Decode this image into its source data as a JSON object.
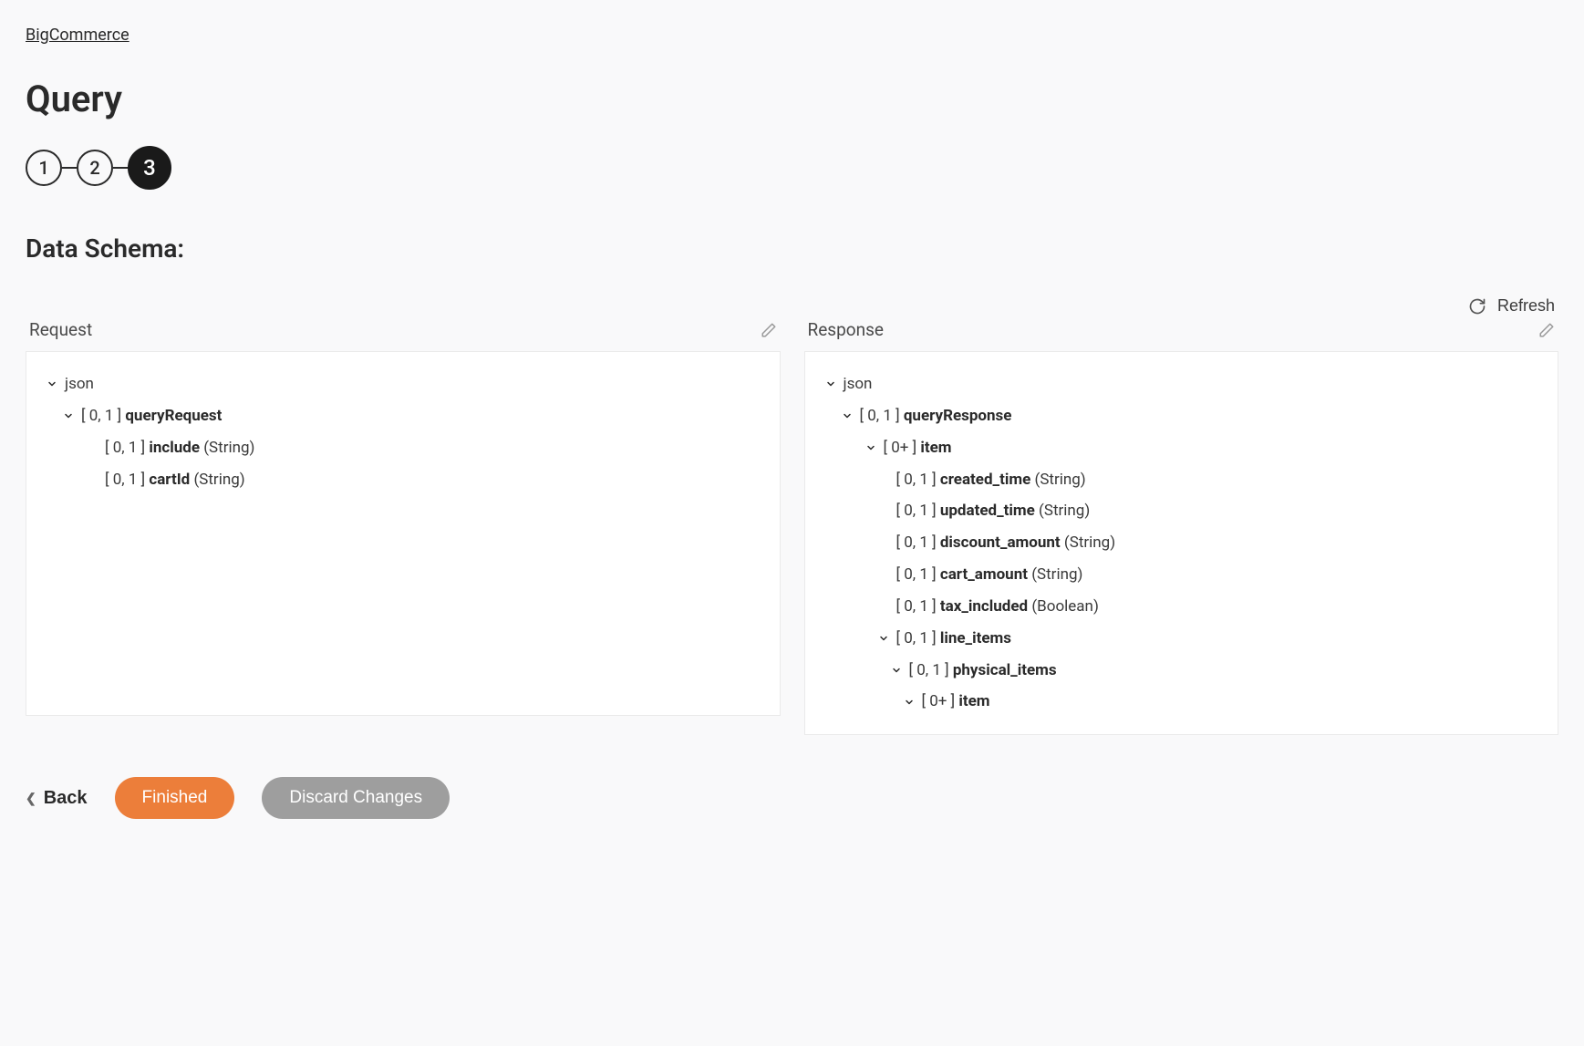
{
  "breadcrumb": {
    "label": "BigCommerce"
  },
  "page": {
    "title": "Query"
  },
  "stepper": {
    "steps": [
      "1",
      "2",
      "3"
    ],
    "activeIndex": 2
  },
  "section": {
    "title": "Data Schema:"
  },
  "refresh": {
    "label": "Refresh"
  },
  "request": {
    "label": "Request",
    "tree": [
      {
        "indent": 0,
        "chev": true,
        "text": "json"
      },
      {
        "indent": 1,
        "chev": true,
        "cardinality": "[ 0, 1 ]",
        "name": "queryRequest"
      },
      {
        "indent": 2,
        "chev": false,
        "cardinality": "[ 0, 1 ]",
        "name": "include",
        "type": "(String)"
      },
      {
        "indent": 2,
        "chev": false,
        "cardinality": "[ 0, 1 ]",
        "name": "cartId",
        "type": "(String)"
      }
    ]
  },
  "response": {
    "label": "Response",
    "tree": [
      {
        "indent": 0,
        "chev": true,
        "text": "json"
      },
      {
        "indent": 1,
        "chev": true,
        "cardinality": "[ 0, 1 ]",
        "name": "queryResponse"
      },
      {
        "indent": 2,
        "chev": true,
        "cardinality": "[ 0+ ]",
        "name": "item"
      },
      {
        "indent": 3,
        "chev": false,
        "cardinality": "[ 0, 1 ]",
        "name": "created_time",
        "type": "(String)"
      },
      {
        "indent": 3,
        "chev": false,
        "cardinality": "[ 0, 1 ]",
        "name": "updated_time",
        "type": "(String)"
      },
      {
        "indent": 3,
        "chev": false,
        "cardinality": "[ 0, 1 ]",
        "name": "discount_amount",
        "type": "(String)"
      },
      {
        "indent": 3,
        "chev": false,
        "cardinality": "[ 0, 1 ]",
        "name": "cart_amount",
        "type": "(String)"
      },
      {
        "indent": 3,
        "chev": false,
        "cardinality": "[ 0, 1 ]",
        "name": "tax_included",
        "type": "(Boolean)"
      },
      {
        "indent": 3,
        "chev": true,
        "cardinality": "[ 0, 1 ]",
        "name": "line_items"
      },
      {
        "indent": 4,
        "chev": true,
        "cardinality": "[ 0, 1 ]",
        "name": "physical_items"
      },
      {
        "indent": 5,
        "chev": true,
        "cardinality": "[ 0+ ]",
        "name": "item"
      }
    ]
  },
  "footer": {
    "back": "Back",
    "finished": "Finished",
    "discard": "Discard Changes"
  }
}
